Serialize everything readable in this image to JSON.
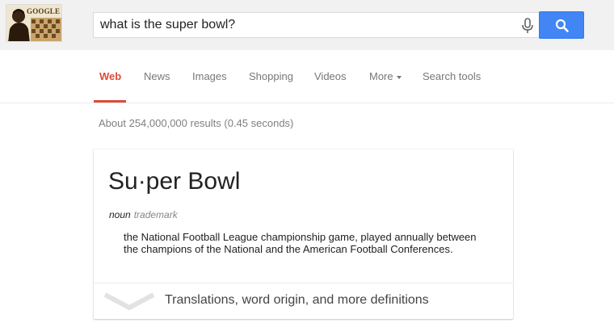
{
  "header": {
    "doodle_text": "GOOGLE",
    "search_query": "what is the super bowl?",
    "mic_icon": "microphone-icon",
    "search_icon": "search-icon"
  },
  "tabs": [
    {
      "label": "Web",
      "active": true
    },
    {
      "label": "News",
      "active": false
    },
    {
      "label": "Images",
      "active": false
    },
    {
      "label": "Shopping",
      "active": false
    },
    {
      "label": "Videos",
      "active": false
    },
    {
      "label": "More",
      "active": false
    },
    {
      "label": "Search tools",
      "active": false
    }
  ],
  "results_stats": "About 254,000,000 results (0.45 seconds)",
  "definition_card": {
    "word": "Su·per Bowl",
    "part_of_speech": "noun",
    "label": "trademark",
    "definition": "the National Football League championship game, played annually between the champions of the National and the American Football Conferences.",
    "more_link": "Translations, word origin, and more definitions"
  },
  "colors": {
    "accent_red": "#dd4b39",
    "search_blue": "#4285f4",
    "header_bg": "#f1f1f1"
  }
}
